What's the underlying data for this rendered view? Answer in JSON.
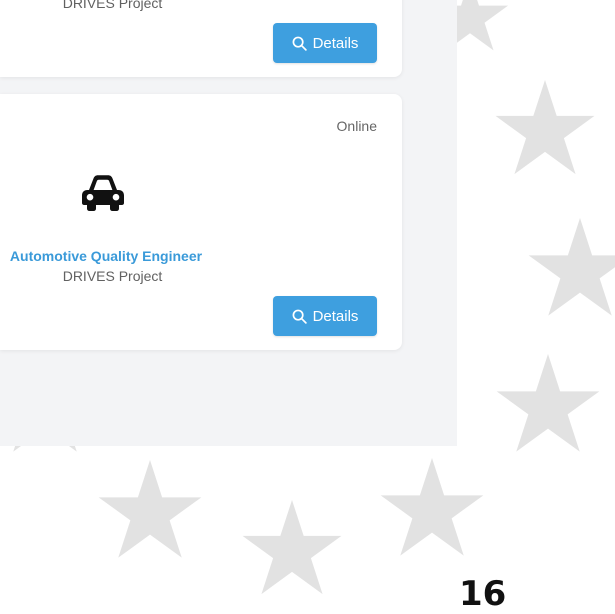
{
  "cards": [
    {
      "organization": "DRIVES Project",
      "details_label": "Details"
    },
    {
      "status": "Online",
      "icon": "car-icon",
      "title": "Automotive Quality Engineer",
      "organization": "DRIVES Project",
      "details_label": "Details"
    }
  ],
  "page_number": "16",
  "colors": {
    "accent": "#3e9fdf",
    "title": "#3a9ad9",
    "panel_background": "#f3f4f6",
    "star": "#e2e2e2"
  }
}
